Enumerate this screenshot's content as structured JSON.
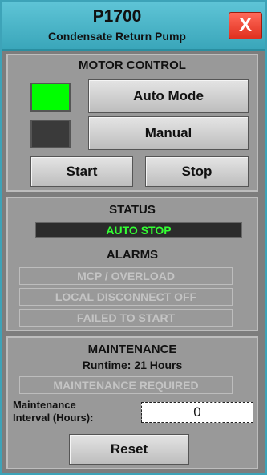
{
  "titlebar": {
    "title": "P1700",
    "subtitle": "Condensate Return Pump",
    "close_label": "X"
  },
  "motor_control": {
    "header": "MOTOR CONTROL",
    "auto_label": "Auto Mode",
    "manual_label": "Manual",
    "start_label": "Start",
    "stop_label": "Stop",
    "auto_lamp_color": "#00ff00",
    "manual_lamp_color": "#3a3a3a"
  },
  "status": {
    "header": "STATUS",
    "value": "AUTO STOP",
    "value_color": "#33ff33"
  },
  "alarms": {
    "header": "ALARMS",
    "items": [
      "MCP / OVERLOAD",
      "LOCAL DISCONNECT OFF",
      "FAILED TO START"
    ]
  },
  "maintenance": {
    "header": "MAINTENANCE",
    "runtime": "Runtime: 21 Hours",
    "required": "MAINTENANCE REQUIRED",
    "interval_label_1": "Maintenance",
    "interval_label_2": "Interval (Hours):",
    "interval_value": "0",
    "reset_label": "Reset"
  }
}
